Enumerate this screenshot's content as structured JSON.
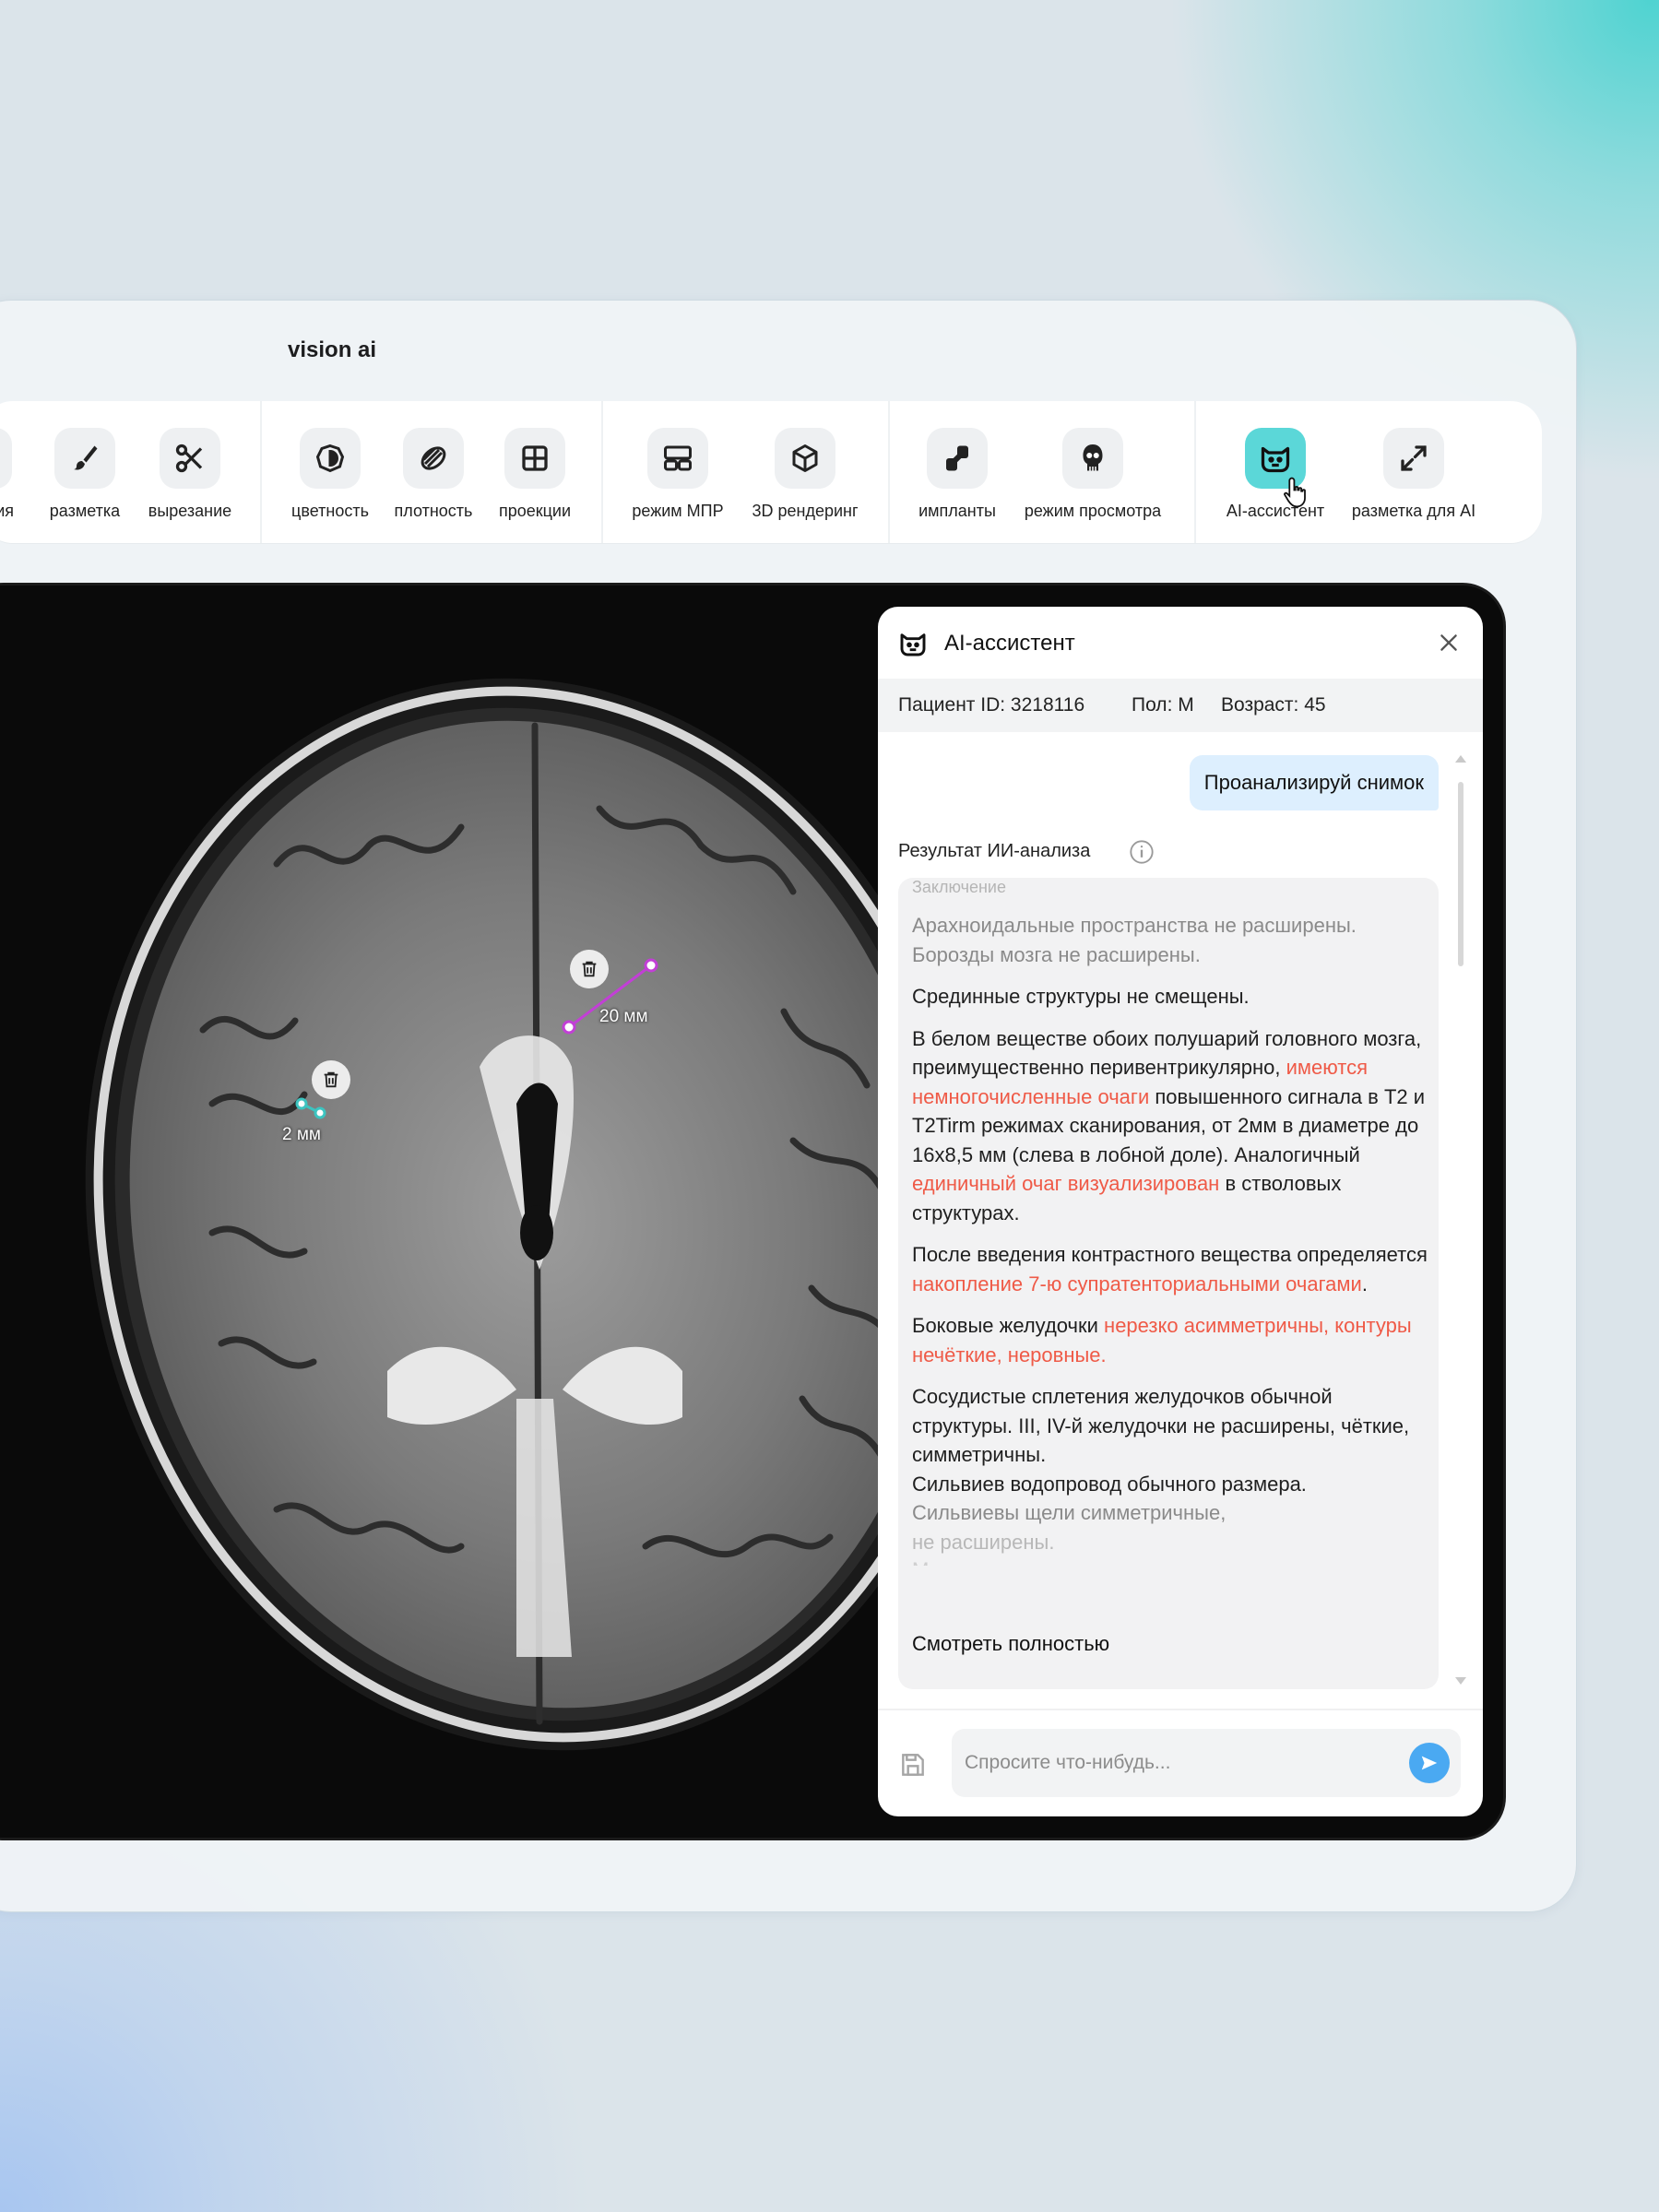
{
  "app": {
    "title": "vision ai"
  },
  "toolbar": {
    "tools": [
      {
        "name": "partial",
        "label": "ния",
        "icon": "partial-icon"
      },
      {
        "name": "markup",
        "label": "разметка",
        "icon": "brush-icon"
      },
      {
        "name": "cut",
        "label": "вырезание",
        "icon": "scissors-icon"
      },
      {
        "name": "color",
        "label": "цветность",
        "icon": "contrast-icon"
      },
      {
        "name": "density",
        "label": "плотность",
        "icon": "density-icon"
      },
      {
        "name": "projections",
        "label": "проекции",
        "icon": "grid-icon"
      },
      {
        "name": "mpr",
        "label": "режим МПР",
        "icon": "layout-icon"
      },
      {
        "name": "render3d",
        "label": "3D рендеринг",
        "icon": "cube-icon"
      },
      {
        "name": "implants",
        "label": "импланты",
        "icon": "implant-icon"
      },
      {
        "name": "view-mode",
        "label": "режим просмотра",
        "icon": "skull-icon"
      },
      {
        "name": "ai-assistant",
        "label": "AI-ассистент",
        "icon": "bot-icon",
        "active": true
      },
      {
        "name": "ai-markup",
        "label": "разметка для AI",
        "icon": "expand-icon"
      }
    ]
  },
  "viewer": {
    "measurements": [
      {
        "label": "20 мм",
        "color": "#c23fd6"
      },
      {
        "label": "2 мм",
        "color": "#3cc4c0"
      }
    ]
  },
  "assistant": {
    "title": "AI-ассистент",
    "patient": {
      "id_text": "Пациент ID: 3218116",
      "sex_text": "Пол: М",
      "age_text": "Возраст: 45"
    },
    "user_message": "Проанализируй снимок",
    "result_title": "Результат ИИ-анализа",
    "result": {
      "faded_top": "Заключение",
      "p1": "Арахноидальные пространства не расширены. Борозды мозга не расширены.",
      "p2": "Срединные структуры не смещены.",
      "p3_a": "В белом веществе обоих полушарий головного мозга, преимущественно перивентрикулярно, ",
      "p3_b": "имеются немногочисленные очаги",
      "p3_c": " повышенного сигнала в Т2 и T2Tirm режимах сканирования, от 2мм в диаметре до 16х8,5 мм (слева в лобной доле). Аналогичный ",
      "p3_d": "единичный очаг визуализирован",
      "p3_e": " в стволовых структурах.",
      "p4_a": "После введения контрастного вещества определяется ",
      "p4_b": "накопление 7-ю супратенториальными очагами",
      "p4_c": ".",
      "p5_a": "Боковые желудочки ",
      "p5_b": "нерезко асимметричны, контуры нечёткие, неровные.",
      "p6_l1": "Сосудистые сплетения желудочков обычной структуры. III, IV-й желудочки не расширены, чёткие, симметричны.",
      "p6_l2": "Сильвиев водопровод обычного размера.",
      "p6_l3": "Сильвиевы щели симметричные,",
      "p6_l4": "не расширены.",
      "p6_l5": "Мозговая цистерна симметричная"
    },
    "view_full": "Смотреть полностью",
    "input_placeholder": "Спросите что-нибудь..."
  },
  "colors": {
    "accent": "#5bd7d8",
    "highlight": "#ef5a47",
    "send": "#4aa9f2",
    "bubble": "#ddeffe"
  }
}
